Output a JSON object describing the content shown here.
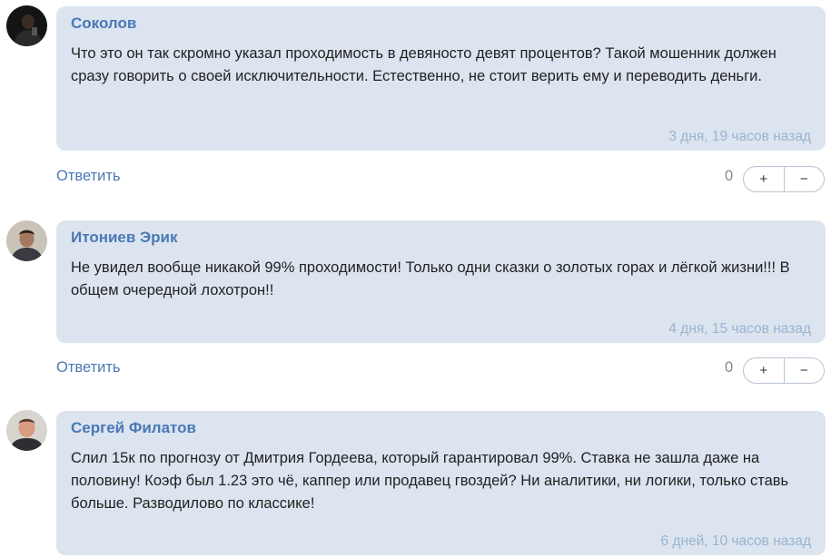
{
  "comments": [
    {
      "author": "Соколов",
      "text": "Что это он так скромно указал проходимость в девяносто девят процентов? Такой мошенник должен сразу говорить о своей исключительности. Естественно, не стоит верить ему и переводить деньги.",
      "time": "3 дня, 19 часов назад",
      "reply": "Ответить",
      "score": "0",
      "plus": "+",
      "minus": "−"
    },
    {
      "author": "Итониев Эрик",
      "text": "Не увидел вообще никакой 99% проходимости! Только одни сказки о золотых горах и лёгкой жизни!!! В общем очередной лохотрон!!",
      "time": "4 дня, 15 часов назад",
      "reply": "Ответить",
      "score": "0",
      "plus": "+",
      "minus": "−"
    },
    {
      "author": "Сергей Филатов",
      "text": "Слил 15к по прогнозу от Дмитрия Гордеева, который гарантировал 99%. Ставка не зашла даже на половину! Коэф был 1.23 это чё, каппер или продавец гвоздей? Ни аналитики, ни логики, только ставь больше. Разводилово по классике!",
      "time": "6 дней, 10 часов назад"
    }
  ],
  "colors": {
    "bubble": "#dbe4ef",
    "author": "#4a78b5",
    "time": "#9bb3d1",
    "link": "#4a78b5"
  }
}
